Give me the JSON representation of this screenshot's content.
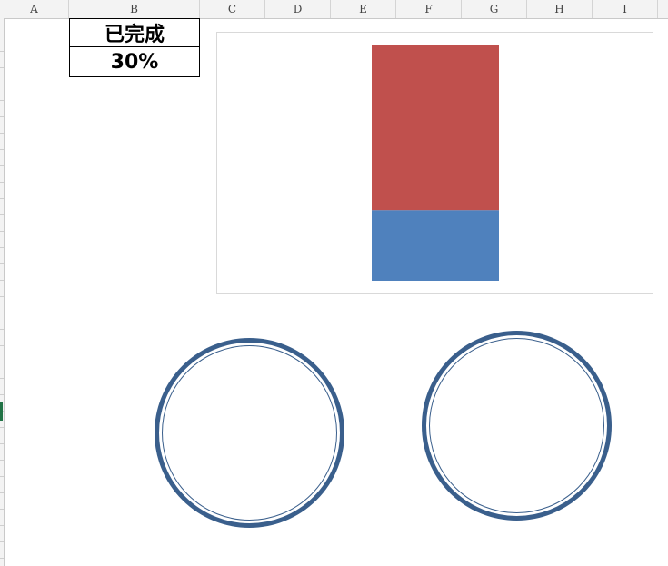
{
  "columns": [
    "A",
    "B",
    "C",
    "D",
    "E",
    "F",
    "G",
    "H",
    "I"
  ],
  "cells": {
    "header_text": "已完成",
    "value_text": "30%"
  },
  "progress": {
    "completed_fraction": 0.3,
    "completed_color": "#4f81bd",
    "remaining_color": "#c0504d"
  },
  "shapes": {
    "circle_color": "#3a5f8c"
  },
  "ui": {
    "active_row_indicator_color": "#217346"
  }
}
